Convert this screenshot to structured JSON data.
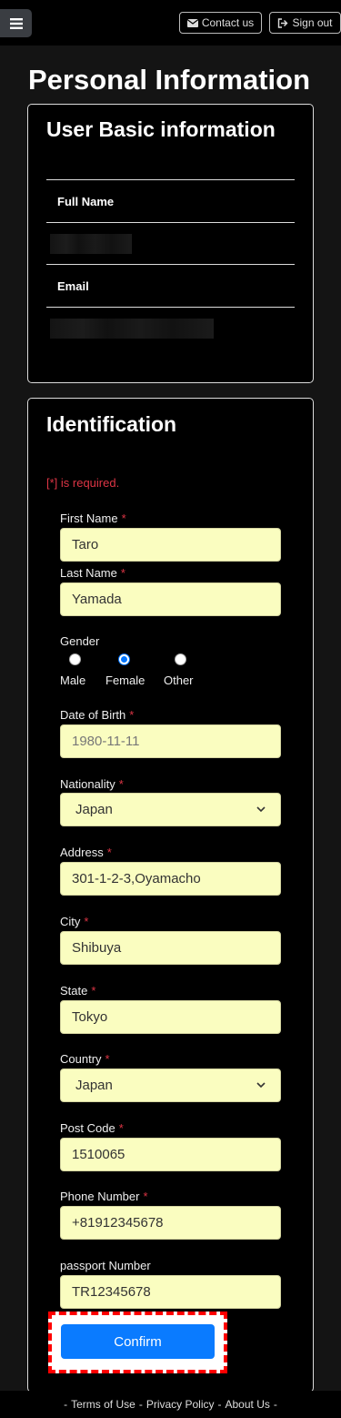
{
  "header": {
    "menu_icon": "hamburger-icon",
    "contact_label": "Contact us",
    "contact_icon": "envelope-icon",
    "signout_label": "Sign out",
    "signout_icon": "sign-out-icon"
  },
  "page_title": "Personal Information",
  "basic_info": {
    "title": "User Basic information",
    "full_name_label": "Full Name",
    "email_label": "Email"
  },
  "identification": {
    "title": "Identification",
    "required_note": "[*] is required.",
    "required_mark": "*",
    "first_name": {
      "label": "First Name",
      "value": "Taro"
    },
    "last_name": {
      "label": "Last Name",
      "value": "Yamada"
    },
    "gender": {
      "label": "Gender",
      "options": [
        "Male",
        "Female",
        "Other"
      ],
      "selected": "Female"
    },
    "dob": {
      "label": "Date of Birth",
      "placeholder": "1980-11-11"
    },
    "nationality": {
      "label": "Nationality",
      "value": "Japan"
    },
    "address": {
      "label": "Address",
      "value": "301-1-2-3,Oyamacho"
    },
    "city": {
      "label": "City",
      "value": "Shibuya"
    },
    "state": {
      "label": "State",
      "value": "Tokyo"
    },
    "country": {
      "label": "Country",
      "value": "Japan"
    },
    "post_code": {
      "label": "Post Code",
      "value": "1510065"
    },
    "phone": {
      "label": "Phone Number",
      "value": "+81912345678"
    },
    "passport": {
      "label": "passport Number",
      "value": "TR12345678"
    },
    "confirm_label": "Confirm"
  },
  "footer": {
    "dash": "-",
    "terms": "Terms of Use",
    "privacy": "Privacy Policy",
    "about": "About Us"
  },
  "colors": {
    "accent": "#0a7bff",
    "required": "#dc3545",
    "input_bg": "#fafdc0",
    "highlight": "#ff0000"
  }
}
